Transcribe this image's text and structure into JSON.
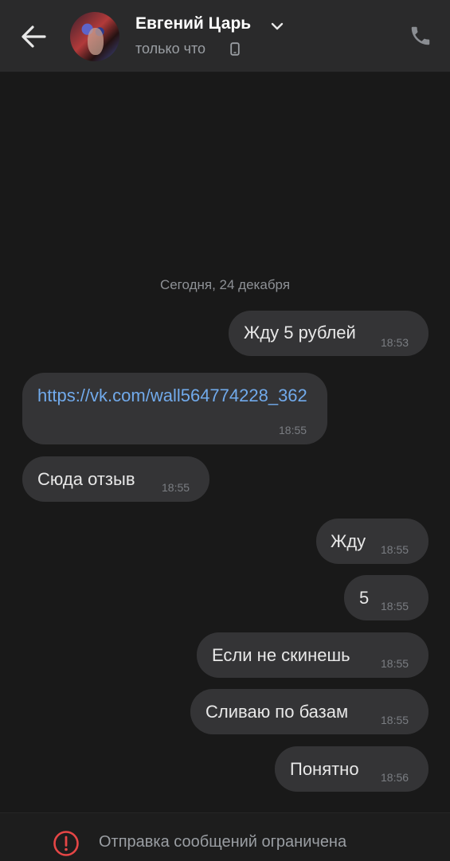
{
  "header": {
    "contact_name": "Евгений Царь",
    "status": "только что"
  },
  "chat": {
    "date_separator": "Сегодня, 24 декабря",
    "messages": [
      {
        "direction": "out",
        "text": "Жду 5 рублей",
        "time": "18:53"
      },
      {
        "direction": "in",
        "text": "https://vk.com/wall564774228_362",
        "time": "18:55"
      },
      {
        "direction": "in",
        "text": "Сюда отзыв",
        "time": "18:55"
      },
      {
        "direction": "out",
        "text": "Жду",
        "time": "18:55"
      },
      {
        "direction": "out",
        "text": "5",
        "time": "18:55"
      },
      {
        "direction": "out",
        "text": "Если не скинешь",
        "time": "18:55"
      },
      {
        "direction": "out",
        "text": "Сливаю по базам",
        "time": "18:55"
      },
      {
        "direction": "out",
        "text": "Понятно",
        "time": "18:56"
      }
    ]
  },
  "footer": {
    "notice": "Отправка сообщений ограничена"
  },
  "colors": {
    "background": "#191919",
    "header": "#2a2a2b",
    "bubble": "#343436",
    "link": "#71aaeb",
    "warning": "#e64646"
  }
}
